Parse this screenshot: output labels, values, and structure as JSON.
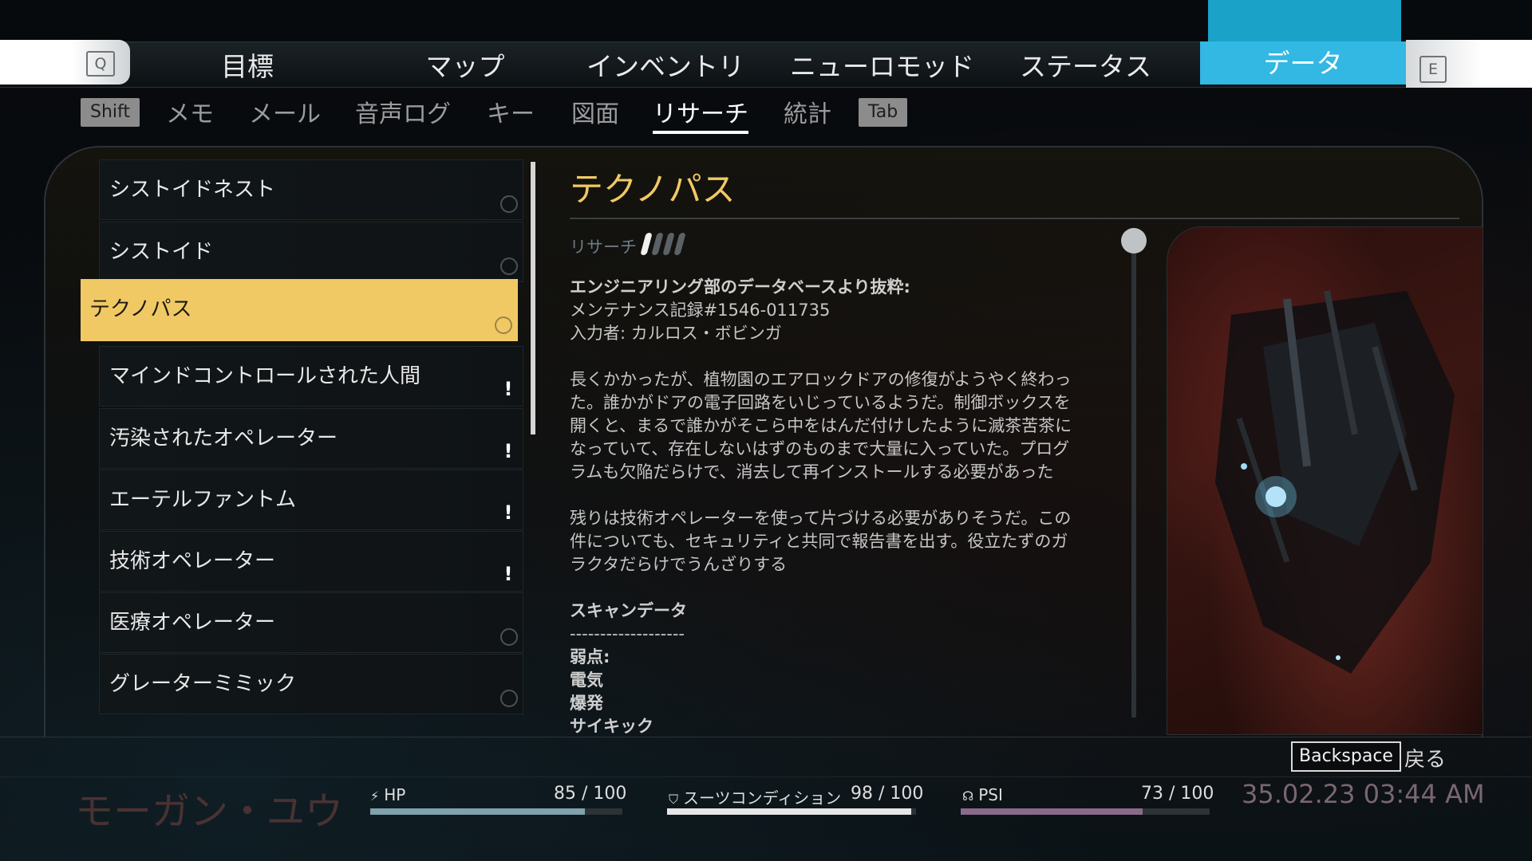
{
  "nav": {
    "left_key": "Q",
    "right_key": "E",
    "tabs": [
      "目標",
      "マップ",
      "インベントリ",
      "ニューロモッド",
      "ステータス",
      "データ"
    ],
    "active_tab": "データ"
  },
  "subnav": {
    "left_key": "Shift",
    "right_key": "Tab",
    "tabs": [
      "メモ",
      "メール",
      "音声ログ",
      "キー",
      "図面",
      "リサーチ",
      "統計"
    ],
    "active_tab": "リサーチ"
  },
  "list": {
    "items": [
      {
        "label": "シストイドネスト",
        "marker": "ring"
      },
      {
        "label": "シストイド",
        "marker": "ring"
      },
      {
        "label": "テクノパス",
        "marker": "ring",
        "selected": true
      },
      {
        "label": "マインドコントロールされた人間",
        "marker": "alert"
      },
      {
        "label": "汚染されたオペレーター",
        "marker": "alert"
      },
      {
        "label": "エーテルファントム",
        "marker": "alert"
      },
      {
        "label": "技術オペレーター",
        "marker": "alert"
      },
      {
        "label": "医療オペレーター",
        "marker": "ring"
      },
      {
        "label": "グレーターミミック",
        "marker": "ring"
      }
    ],
    "alert_glyph": "!"
  },
  "detail": {
    "title": "テクノパス",
    "research_label": "リサーチ",
    "research_progress": {
      "filled": 1,
      "total": 4
    },
    "header_bold": "エンジニアリング部のデータベースより抜粋:",
    "record_line": "メンテナンス記録#1546-011735",
    "author_line": "入力者: カルロス・ボビンガ",
    "paragraph1": [
      "長くかかったが、植物園のエアロックドアの修復がようやく終わっ",
      "た。誰かがドアの電子回路をいじっているようだ。制御ボックスを",
      "開くと、まるで誰かがそこら中をはんだ付けしたように滅茶苦茶に",
      "なっていて、存在しないはずのものまで大量に入っていた。プログ",
      "ラムも欠陥だらけで、消去して再インストールする必要があった"
    ],
    "paragraph2": [
      "残りは技術オペレーターを使って片づける必要がありそうだ。この",
      "件についても、セキュリティと共同で報告書を出す。役立たずのガ",
      "ラクタだらけでうんざりする"
    ],
    "scan_title": "スキャンデータ",
    "scan_divider": "-------------------",
    "weakness_label": "弱点:",
    "weaknesses": [
      "電気",
      "爆発",
      "サイキック"
    ]
  },
  "footer": {
    "back_key": "Backspace",
    "back_label": "戻る",
    "player_name": "モーガン・ユウ",
    "hp": {
      "label": "HP",
      "value": "85 / 100",
      "fraction": 0.85,
      "color": "#7fa2ad"
    },
    "suit": {
      "label": "スーツコンディション",
      "value": "98 / 100",
      "fraction": 0.98,
      "color": "#e6e6e6"
    },
    "psi": {
      "label": "PSI",
      "value": "73 / 100",
      "fraction": 0.73,
      "color": "#8a6a8a"
    },
    "datetime": "35.02.23 03:44 AM"
  }
}
